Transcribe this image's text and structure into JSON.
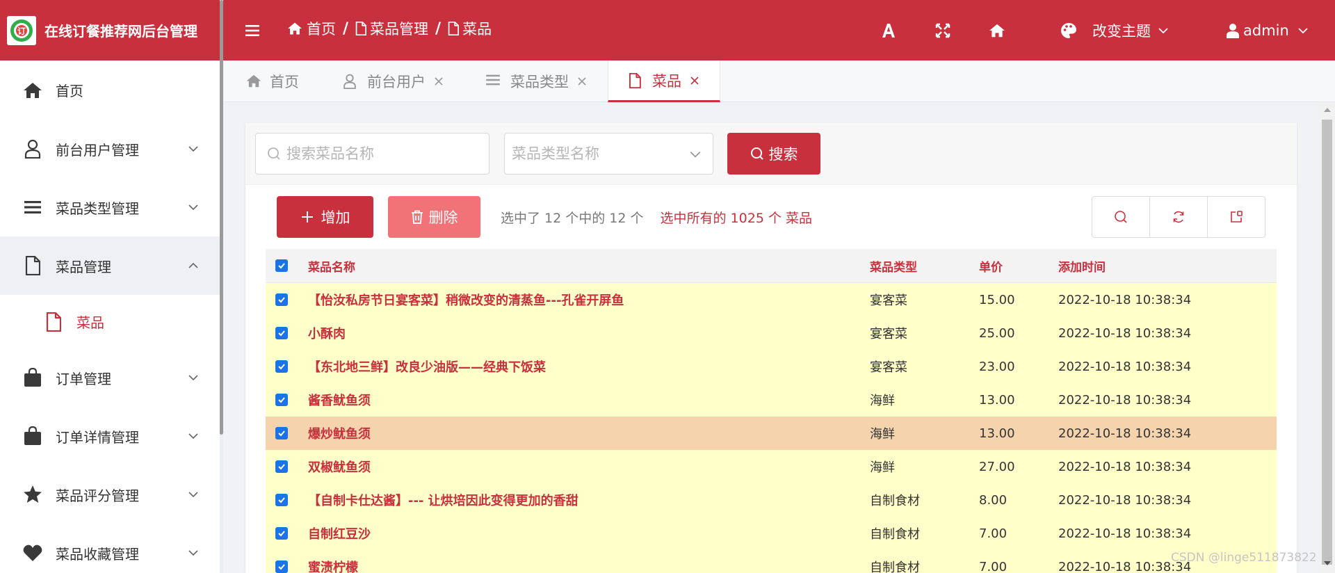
{
  "app": {
    "title": "在线订餐推荐网后台管理",
    "theme_color": "#c9303d"
  },
  "header": {
    "breadcrumb": [
      "首页",
      "菜品管理",
      "菜品"
    ],
    "breadcrumb_separator": "/",
    "theme_label": "改变主题",
    "user_label": "admin",
    "icons": [
      "menu-toggle-icon",
      "font-size-icon",
      "fullscreen-icon",
      "home-icon",
      "palette-icon",
      "user-icon"
    ]
  },
  "sidebar": {
    "items": [
      {
        "label": "首页",
        "icon": "home-icon"
      },
      {
        "label": "前台用户管理",
        "icon": "user-icon"
      },
      {
        "label": "菜品类型管理",
        "icon": "list-icon"
      },
      {
        "label": "菜品管理",
        "icon": "file-icon",
        "expanded": true,
        "children": [
          {
            "label": "菜品",
            "icon": "file-icon",
            "active": true
          }
        ]
      },
      {
        "label": "订单管理",
        "icon": "bag-icon"
      },
      {
        "label": "订单详情管理",
        "icon": "bag-icon"
      },
      {
        "label": "菜品评分管理",
        "icon": "star-icon"
      },
      {
        "label": "菜品收藏管理",
        "icon": "heart-icon"
      }
    ]
  },
  "tabs": [
    {
      "label": "首页",
      "icon": "home-icon",
      "closable": false
    },
    {
      "label": "前台用户",
      "icon": "user-icon",
      "closable": true
    },
    {
      "label": "菜品类型",
      "icon": "list-icon",
      "closable": true
    },
    {
      "label": "菜品",
      "icon": "file-icon",
      "closable": true,
      "active": true
    }
  ],
  "search": {
    "name_placeholder": "搜索菜品名称",
    "type_placeholder": "菜品类型名称",
    "button_label": "搜索"
  },
  "toolbar": {
    "add_label": "增加",
    "delete_label": "删除",
    "selection_text": "选中了 12 个中的 12 个",
    "select_all_text": "选中所有的 1025 个 菜品",
    "tool_icons": [
      "search-icon",
      "refresh-icon",
      "export-icon"
    ]
  },
  "table": {
    "columns": [
      "菜品名称",
      "菜品类型",
      "单价",
      "添加时间"
    ],
    "rows": [
      {
        "name": "【怡汝私房节日宴客菜】稍微改变的清蒸鱼---孔雀开屏鱼",
        "type": "宴客菜",
        "price": "15.00",
        "time": "2022-10-18 10:38:34",
        "checked": true
      },
      {
        "name": "小酥肉",
        "type": "宴客菜",
        "price": "25.00",
        "time": "2022-10-18 10:38:34",
        "checked": true
      },
      {
        "name": "【东北地三鲜】改良少油版——经典下饭菜",
        "type": "宴客菜",
        "price": "23.00",
        "time": "2022-10-18 10:38:34",
        "checked": true
      },
      {
        "name": "酱香鱿鱼须",
        "type": "海鲜",
        "price": "13.00",
        "time": "2022-10-18 10:38:34",
        "checked": true
      },
      {
        "name": "爆炒鱿鱼须",
        "type": "海鲜",
        "price": "13.00",
        "time": "2022-10-18 10:38:34",
        "checked": true,
        "highlight": true
      },
      {
        "name": "双椒鱿鱼须",
        "type": "海鲜",
        "price": "27.00",
        "time": "2022-10-18 10:38:34",
        "checked": true
      },
      {
        "name": "【自制卡仕达酱】--- 让烘培因此变得更加的香甜",
        "type": "自制食材",
        "price": "8.00",
        "time": "2022-10-18 10:38:34",
        "checked": true
      },
      {
        "name": "自制红豆沙",
        "type": "自制食材",
        "price": "7.00",
        "time": "2022-10-18 10:38:34",
        "checked": true
      },
      {
        "name": "蜜渍柠檬",
        "type": "自制食材",
        "price": "7.00",
        "time": "2022-10-18 10:38:34",
        "checked": true
      }
    ]
  },
  "watermark": "CSDN @linge511873822"
}
